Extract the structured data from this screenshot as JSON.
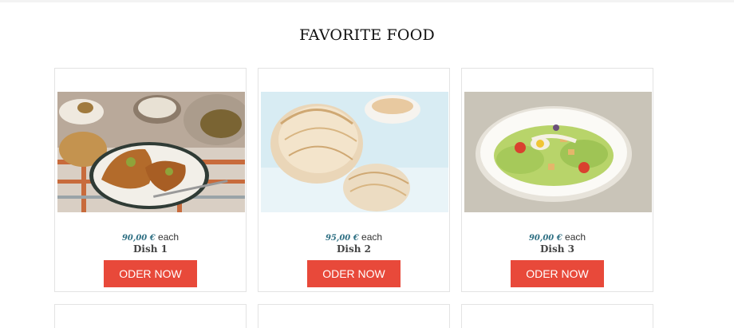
{
  "section": {
    "title": "FAVORITE FOOD"
  },
  "cards": [
    {
      "price": "90,00 €",
      "unit": " each",
      "name": "Dish 1",
      "button": "ODER NOW"
    },
    {
      "price": "95,00 €",
      "unit": " each",
      "name": "Dish 2",
      "button": "ODER NOW"
    },
    {
      "price": "90,00 €",
      "unit": " each",
      "name": "Dish 3",
      "button": "ODER NOW"
    }
  ],
  "colors": {
    "accent": "#e8493a",
    "price": "#2c6e82"
  }
}
